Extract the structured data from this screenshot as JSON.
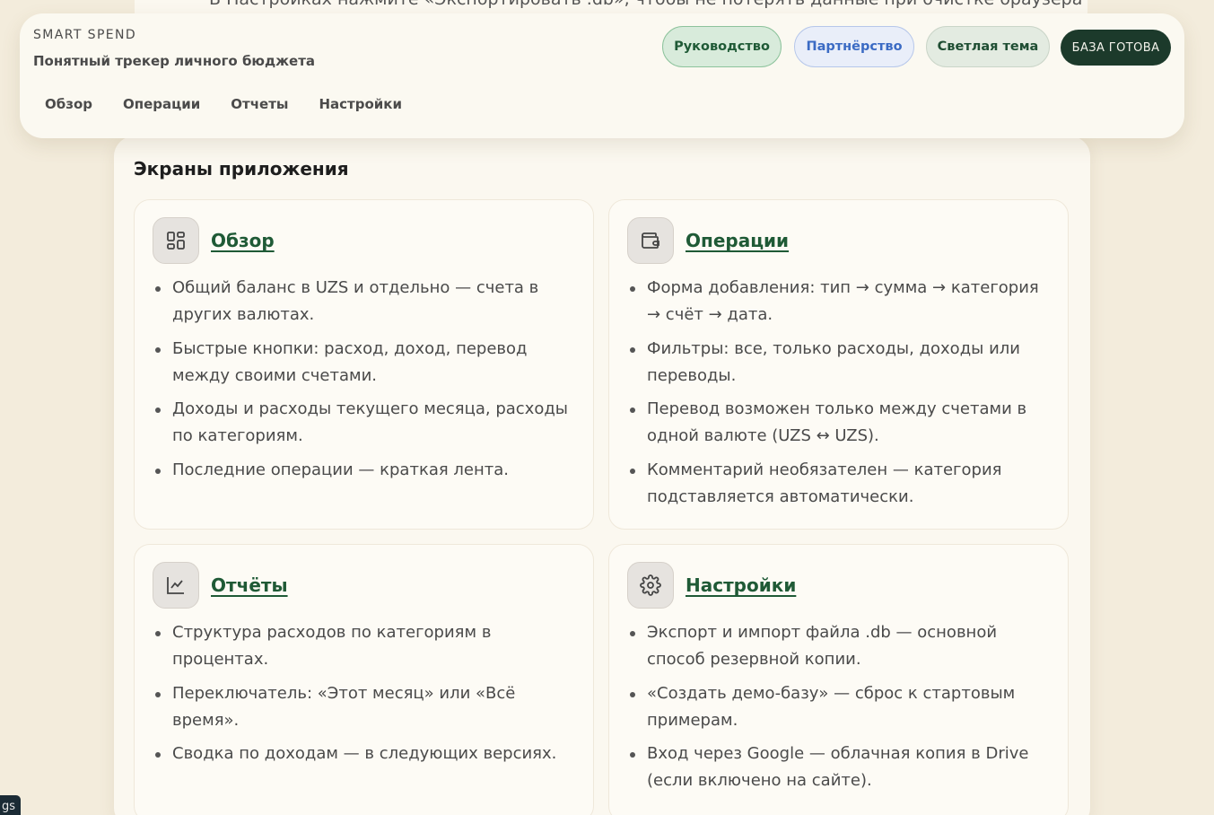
{
  "background": {
    "partial_text": "В Настройках нажмите «Экспортировать .db», чтобы не потерять данные при очистке браузера или"
  },
  "header": {
    "brand": "SMART SPEND",
    "tagline": "Понятный трекер личного бюджета",
    "nav": [
      "Обзор",
      "Операции",
      "Отчеты",
      "Настройки"
    ],
    "buttons": {
      "guide": "Руководство",
      "partner": "Партнёрство",
      "theme": "Светлая тема"
    },
    "status": "БАЗА ГОТОВА"
  },
  "main": {
    "title": "Экраны приложения",
    "cards": [
      {
        "title": "Обзор",
        "icon": "dashboard-icon",
        "items": [
          "Общий баланс в UZS и отдельно — счета в других валютах.",
          "Быстрые кнопки: расход, доход, перевод между своими счетами.",
          "Доходы и расходы текущего месяца, расходы по категориям.",
          "Последние операции — краткая лента."
        ]
      },
      {
        "title": "Операции",
        "icon": "wallet-icon",
        "items": [
          "Форма добавления: тип → сумма → категория → счёт → дата.",
          "Фильтры: все, только расходы, доходы или переводы.",
          "Перевод возможен только между счетами в одной валюте (UZS ↔ UZS).",
          "Комментарий необязателен — категория подставляется автоматически."
        ]
      },
      {
        "title": "Отчёты",
        "icon": "line-chart-icon",
        "items": [
          "Структура расходов по категориям в процентах.",
          "Переключатель: «Этот месяц» или «Всё время».",
          "Сводка по доходам — в следующих версиях."
        ]
      },
      {
        "title": "Настройки",
        "icon": "gear-icon",
        "items": [
          "Экспорт и импорт файла .db — основной способ резервной копии.",
          "«Создать демо-базу» — сброс к стартовым примерам.",
          "Вход через Google — облачная копия в Drive (если включено на сайте)."
        ]
      }
    ]
  },
  "corner_chip": "gs",
  "colors": {
    "accent_green": "#1f5a36",
    "status_dark": "#1c3a2b",
    "partner_blue": "#3b6bc4",
    "page_bg": "#f3ecdc"
  }
}
